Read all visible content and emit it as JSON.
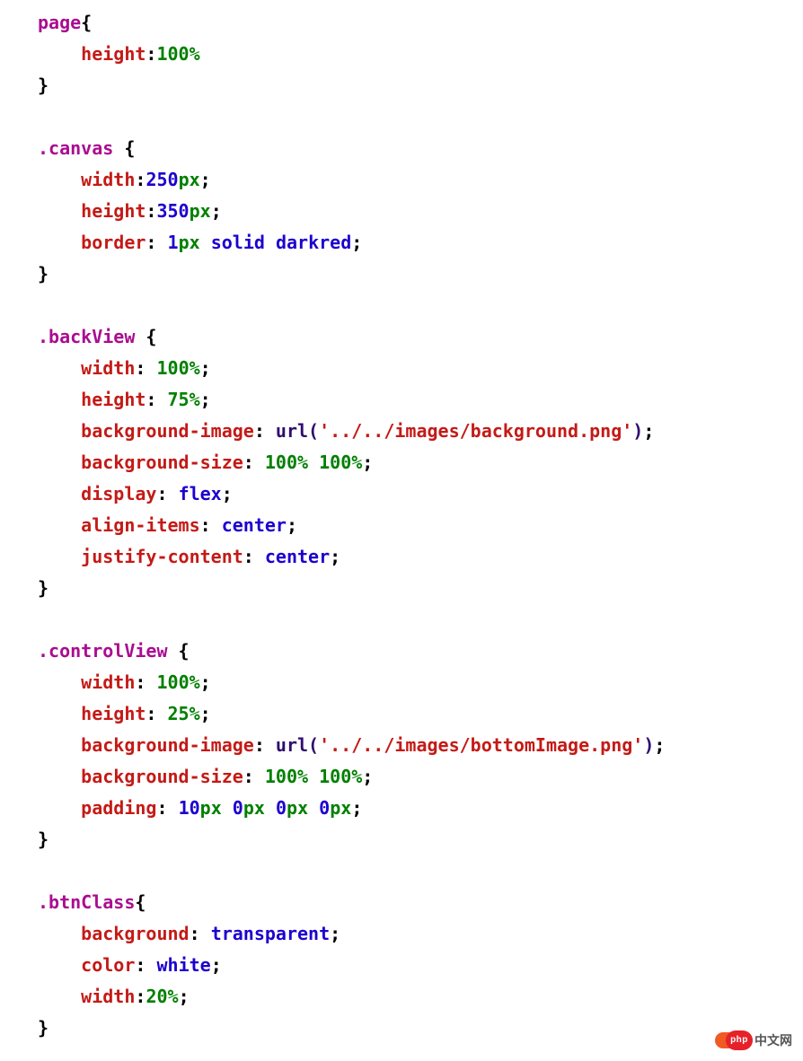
{
  "code": {
    "r1": {
      "sel": "page",
      "brace": "{"
    },
    "r2": {
      "prop": "height",
      "val": "100%"
    },
    "r3": {
      "brace": "}"
    },
    "r5": {
      "sel": ".canvas",
      "brace": " {"
    },
    "r6": {
      "prop": "width",
      "num": "250",
      "unit": "px",
      "semi": ";"
    },
    "r7": {
      "prop": "height",
      "num": "350",
      "unit": "px",
      "semi": ";"
    },
    "r8": {
      "prop": "border",
      "colon": ": ",
      "num": "1",
      "unit": "px",
      "sp": " ",
      "kw1": "solid",
      "sp2": " ",
      "kw2": "darkred",
      "semi": ";"
    },
    "r9": {
      "brace": "}"
    },
    "r11": {
      "sel": ".backView",
      "brace": " {"
    },
    "r12": {
      "prop": "width",
      "colon": ": ",
      "val": "100%",
      "semi": ";"
    },
    "r13": {
      "prop": "height",
      "colon": ": ",
      "val": "75%",
      "semi": ";"
    },
    "r14": {
      "prop": "background-image",
      "colon": ": ",
      "fn": "url(",
      "str": "'../../images/background.png'",
      "close": ")",
      "semi": ";"
    },
    "r15": {
      "prop": "background-size",
      "colon": ": ",
      "v1": "100%",
      "sp": " ",
      "v2": "100%",
      "semi": ";"
    },
    "r16": {
      "prop": "display",
      "colon": ": ",
      "val": "flex",
      "semi": ";"
    },
    "r17": {
      "prop": "align-items",
      "colon": ": ",
      "val": "center",
      "semi": ";"
    },
    "r18": {
      "prop": "justify-content",
      "colon": ": ",
      "val": "center",
      "semi": ";"
    },
    "r19": {
      "brace": "}"
    },
    "r21": {
      "sel": ".controlView",
      "brace": " {"
    },
    "r22": {
      "prop": "width",
      "colon": ": ",
      "val": "100%",
      "semi": ";"
    },
    "r23": {
      "prop": "height",
      "colon": ": ",
      "val": "25%",
      "semi": ";"
    },
    "r24": {
      "prop": "background-image",
      "colon": ": ",
      "fn": "url(",
      "str": "'../../images/bottomImage.png'",
      "close": ")",
      "semi": ";"
    },
    "r25": {
      "prop": "background-size",
      "colon": ": ",
      "v1": "100%",
      "sp": " ",
      "v2": "100%",
      "semi": ";"
    },
    "r26": {
      "prop": "padding",
      "colon": ": ",
      "n1": "10",
      "u1": "px",
      "s1": " ",
      "n2": "0",
      "u2": "px",
      "s2": " ",
      "n3": "0",
      "u3": "px",
      "s3": " ",
      "n4": "0",
      "u4": "px",
      "semi": ";"
    },
    "r27": {
      "brace": "}"
    },
    "r29": {
      "sel": ".btnClass",
      "brace": "{"
    },
    "r30": {
      "prop": "background",
      "colon": ": ",
      "val": "transparent",
      "semi": ";"
    },
    "r31": {
      "prop": "color",
      "colon": ": ",
      "val": "white",
      "semi": ";"
    },
    "r32": {
      "prop": "width",
      "val": "20%",
      "semi": ";"
    },
    "r33": {
      "brace": "}"
    }
  },
  "watermark": {
    "badge": "php",
    "text": "中文网"
  }
}
